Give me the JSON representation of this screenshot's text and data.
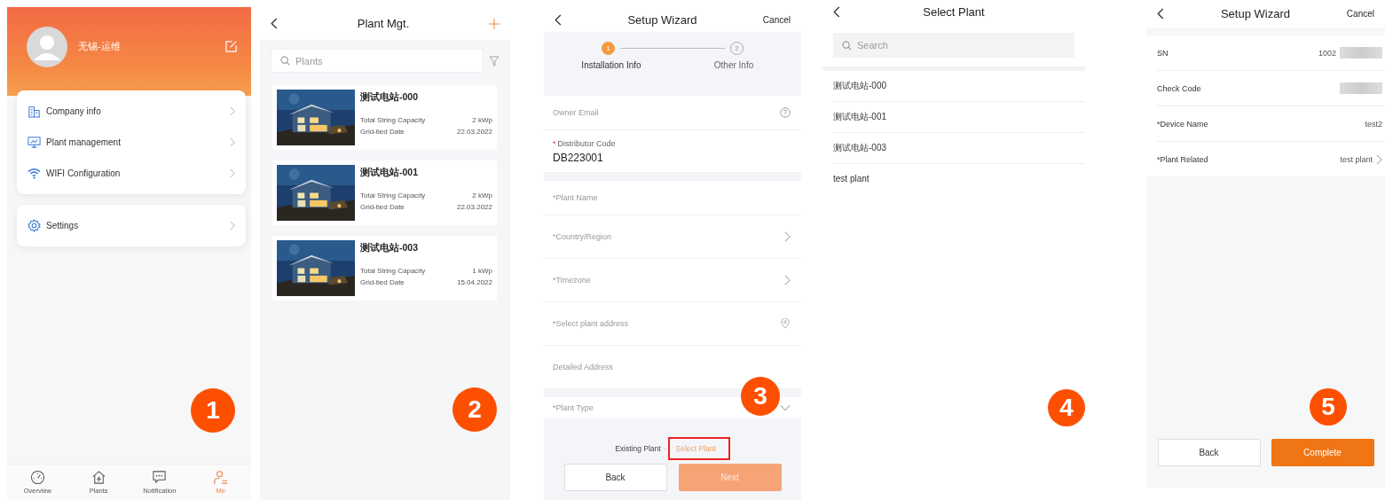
{
  "me_screen": {
    "step_badge": "1",
    "user_name": "无锡-运维",
    "menu_groups": [
      [
        {
          "label": "Company info"
        },
        {
          "label": "Plant management"
        },
        {
          "label": "WIFI Configuration"
        }
      ],
      [
        {
          "label": "Settings"
        }
      ]
    ],
    "tabs": [
      {
        "label": "Overview",
        "selected": false
      },
      {
        "label": "Plants",
        "selected": false
      },
      {
        "label": "Notification",
        "selected": false
      },
      {
        "label": "Me",
        "selected": true
      }
    ]
  },
  "plant_list_screen": {
    "step_badge": "2",
    "title": "Plant Mgt.",
    "search": {
      "placeholder": "Plants"
    },
    "plants": [
      {
        "name": "测试电站-000",
        "capacity_label": "Total String Capacity",
        "capacity": "2 kWp",
        "date_label": "Grid-tied Date",
        "date": "22.03.2022"
      },
      {
        "name": "测试电站-001",
        "capacity_label": "Total String Capacity",
        "capacity": "2 kWp",
        "date_label": "Grid-tied Date",
        "date": "22.03.2022"
      },
      {
        "name": "测试电站-003",
        "capacity_label": "Total String Capacity",
        "capacity": "1 kWp",
        "date_label": "Grid-tied Date",
        "date": "15.04.2022"
      }
    ]
  },
  "setup_wizard_screen": {
    "step_badge": "3",
    "title": "Setup Wizard",
    "cancel": "Cancel",
    "steps": [
      {
        "number": "1",
        "label": "Installation Info",
        "selected": true
      },
      {
        "number": "2",
        "label": "Other Info",
        "selected": false
      }
    ],
    "field_groups": [
      [
        {
          "kind": "help",
          "placeholder": "Owner Email"
        },
        {
          "kind": "labeled",
          "required_mark": "*",
          "label": "Distributor Code",
          "value": "DB223001"
        }
      ],
      [
        {
          "kind": "plain",
          "placeholder": "*Plant Name"
        },
        {
          "kind": "chevron",
          "placeholder": "*Country/Region"
        },
        {
          "kind": "chevron",
          "placeholder": "*Timezone"
        },
        {
          "kind": "location",
          "placeholder": "*Select plant address"
        },
        {
          "kind": "plain",
          "placeholder": "Detailed Address"
        }
      ],
      [
        {
          "kind": "dropdown",
          "placeholder": "*Plant Type"
        }
      ]
    ],
    "existing_label": "Existing Plant",
    "existing_separator": "·",
    "existing_link": "Select Plant",
    "buttons": [
      {
        "label": "Back",
        "kind": "secondary",
        "disabled": false
      },
      {
        "label": "Next",
        "kind": "primary",
        "disabled": true
      }
    ]
  },
  "select_plant_screen": {
    "step_badge": "4",
    "title": "Select Plant",
    "search": {
      "placeholder": "Search"
    },
    "plants": [
      "测试电站-000",
      "测试电站-001",
      "测试电站-003",
      "test plant"
    ]
  },
  "device_screen": {
    "step_badge": "5",
    "title": "Setup Wizard",
    "cancel": "Cancel",
    "rows": [
      {
        "kind": "redacted",
        "label": "SN",
        "value": "1002"
      },
      {
        "kind": "redacted",
        "label": "Check Code"
      },
      {
        "kind": "text",
        "label": "*Device Name",
        "value": "test2"
      },
      {
        "kind": "chevron",
        "label": "*Plant Related",
        "value": "test plant"
      }
    ],
    "buttons": [
      {
        "label": "Back",
        "kind": "secondary",
        "disabled": false
      },
      {
        "label": "Complete",
        "kind": "primary",
        "disabled": false
      }
    ]
  }
}
